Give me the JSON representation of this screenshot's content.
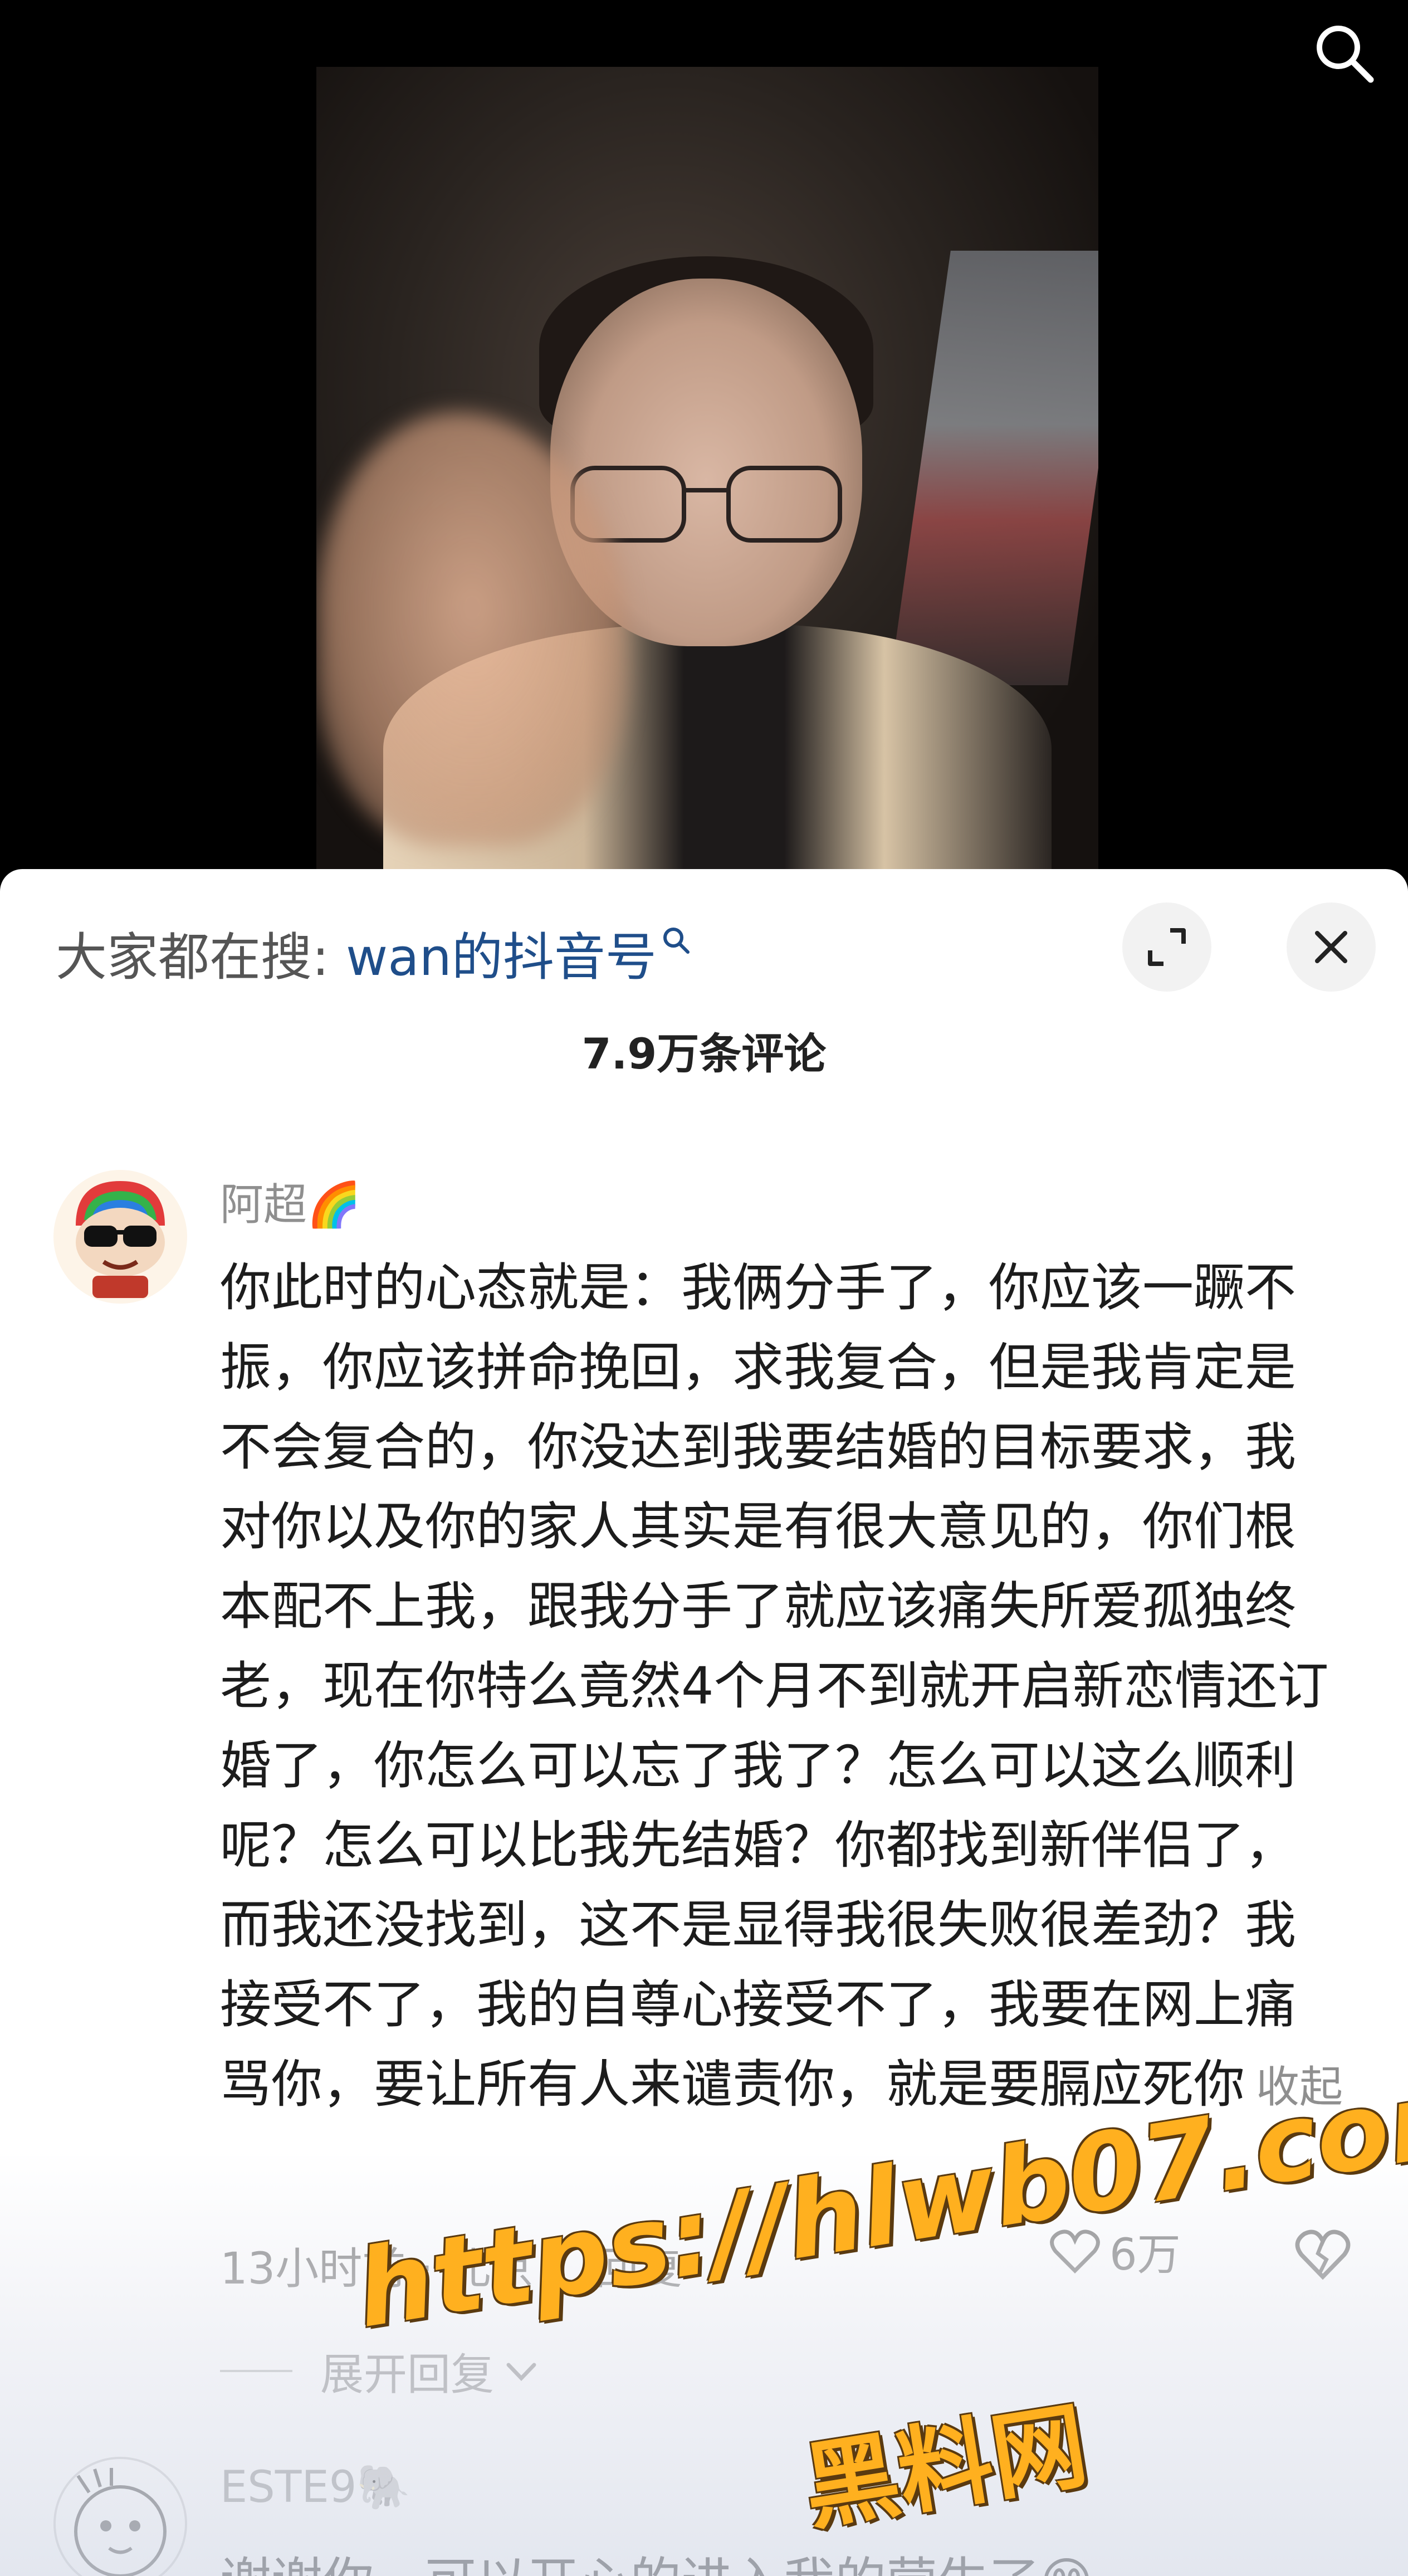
{
  "colors": {
    "link": "#1f4e8a",
    "muted": "#8f8f8f",
    "watermark": "#ffb01f"
  },
  "video": {
    "search_icon": "search-icon"
  },
  "sheet": {
    "suggest_prefix": "大家都在搜:",
    "suggest_link": "wan的抖音号",
    "suggest_icon": "search-icon",
    "expand_icon": "expand-icon",
    "close_icon": "close-icon",
    "comments_count": "7.9万条评论"
  },
  "comments": [
    {
      "username": "阿超🌈",
      "text": "你此时的心态就是：我俩分手了，你应该一蹶不振，你应该拼命挽回，求我复合，但是我肯定是不会复合的，你没达到我要结婚的目标要求，我对你以及你的家人其实是有很大意见的，你们根本配不上我，跟我分手了就应该痛失所爱孤独终老，现在你特么竟然4个月不到就开启新恋情还订婚了，你怎么可以忘了我了？怎么可以这么顺利呢？怎么可以比我先结婚？你都找到新伴侣了，而我还没找到，这不是显得我很失败很差劲？我接受不了，我的自尊心接受不了，我要在网上痛骂你，要让所有人来谴责你，就是要膈应死你",
      "collapse": "收起",
      "time": "13小时前 · 北京",
      "reply": "回复",
      "like_count": "6万",
      "expand_replies": "展开回复"
    },
    {
      "username": "ESTE9🐘",
      "text": "谢谢你，可以开心的进入我的营生了😊"
    }
  ],
  "watermark": {
    "url": "https://hlwb07.com",
    "name": "黑料网"
  }
}
